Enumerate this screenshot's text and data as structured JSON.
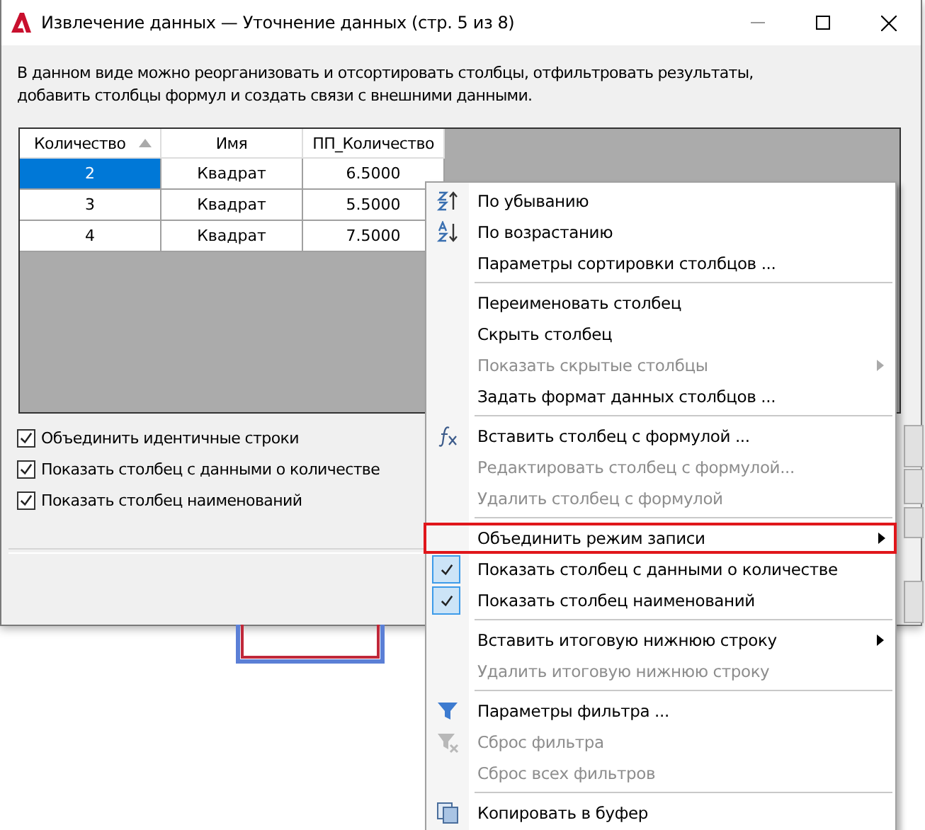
{
  "window": {
    "title": "Извлечение данных — Уточнение данных (стр. 5 из 8)"
  },
  "description": "В данном виде можно реорганизовать и отсортировать столбцы, отфильтровать результаты, добавить столбцы формул и создать связи с внешними данными.",
  "table": {
    "columns": [
      {
        "label": "Количество",
        "sorted": true
      },
      {
        "label": "Имя",
        "sorted": false
      },
      {
        "label": "ПП_Количество",
        "sorted": false
      }
    ],
    "rows": [
      {
        "cells": [
          "2",
          "Квадрат",
          "6.5000"
        ],
        "selected": true
      },
      {
        "cells": [
          "3",
          "Квадрат",
          "5.5000"
        ],
        "selected": false
      },
      {
        "cells": [
          "4",
          "Квадрат",
          "7.5000"
        ],
        "selected": false
      }
    ]
  },
  "options": [
    {
      "label": "Объединить идентичные строки",
      "checked": true
    },
    {
      "label": "Показать столбец с данными о количестве",
      "checked": true
    },
    {
      "label": "Показать столбец наименований",
      "checked": true
    }
  ],
  "context_menu": {
    "items": [
      {
        "kind": "item",
        "label": "По убыванию",
        "disabled": false
      },
      {
        "kind": "item",
        "label": "По возрастанию",
        "disabled": false
      },
      {
        "kind": "item",
        "label": "Параметры сортировки столбцов ...",
        "disabled": false
      },
      {
        "kind": "separator"
      },
      {
        "kind": "item",
        "label": "Переименовать столбец",
        "disabled": false
      },
      {
        "kind": "item",
        "label": "Скрыть столбец",
        "disabled": false
      },
      {
        "kind": "item",
        "label": "Показать скрытые столбцы",
        "disabled": true,
        "submenu": true
      },
      {
        "kind": "item",
        "label": "Задать формат данных столбцов ...",
        "disabled": false
      },
      {
        "kind": "separator"
      },
      {
        "kind": "item",
        "label": "Вставить столбец с формулой ...",
        "disabled": false
      },
      {
        "kind": "item",
        "label": "Редактировать столбец с формулой...",
        "disabled": true
      },
      {
        "kind": "item",
        "label": "Удалить столбец с формулой",
        "disabled": true
      },
      {
        "kind": "separator"
      },
      {
        "kind": "item",
        "label": "Объединить режим записи",
        "disabled": false,
        "submenu": true,
        "highlighted": true
      },
      {
        "kind": "item",
        "label": "Показать столбец с данными о количестве",
        "disabled": false,
        "checked": true
      },
      {
        "kind": "item",
        "label": "Показать столбец наименований",
        "disabled": false,
        "checked": true
      },
      {
        "kind": "separator"
      },
      {
        "kind": "item",
        "label": "Вставить итоговую нижнюю строку",
        "disabled": false,
        "submenu": true
      },
      {
        "kind": "item",
        "label": "Удалить итоговую нижнюю строку",
        "disabled": true
      },
      {
        "kind": "separator"
      },
      {
        "kind": "item",
        "label": "Параметры фильтра ...",
        "disabled": false
      },
      {
        "kind": "item",
        "label": "Сброс фильтра",
        "disabled": true
      },
      {
        "kind": "item",
        "label": "Сброс всех фильтров",
        "disabled": true
      },
      {
        "kind": "separator"
      },
      {
        "kind": "item",
        "label": "Копировать в буфер",
        "disabled": false
      }
    ]
  }
}
